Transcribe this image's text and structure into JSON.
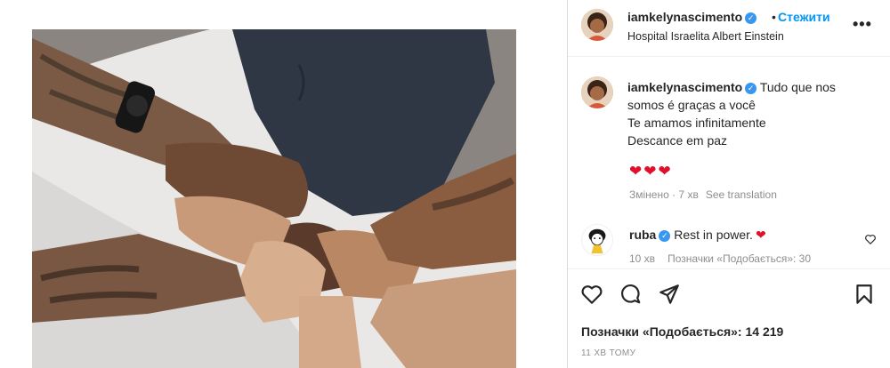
{
  "header": {
    "username": "iamkelynascimento",
    "separator": "•",
    "follow_label": "Стежити",
    "location": "Hospital Israelita Albert Einstein",
    "more_label": "•••"
  },
  "caption": {
    "username": "iamkelynascimento",
    "lines": [
      "Tudo que nos",
      "somos é graças a você",
      "Te amamos infinitamente",
      "Descance em paz"
    ],
    "hearts": "❤❤❤",
    "edited_time": "Змінено · 7 хв",
    "see_translation": "See translation"
  },
  "comment": {
    "username": "ruba",
    "text": "Rest in power.",
    "emoji": "❤",
    "time": "10 хв",
    "likes": "Позначки «Подобається»: 30"
  },
  "post": {
    "likes": "Позначки «Подобається»: 14 219",
    "time_ago": "11 ХВ ТОМУ"
  },
  "icons": {
    "like": "heart-outline-icon",
    "comment": "comment-bubble-icon",
    "share": "paper-plane-icon",
    "save": "bookmark-icon",
    "verified": "verified-badge-icon"
  },
  "colors": {
    "link": "#0095f6",
    "verified": "#3897f0",
    "heart": "#e0102b",
    "muted": "#8e8e8e"
  }
}
